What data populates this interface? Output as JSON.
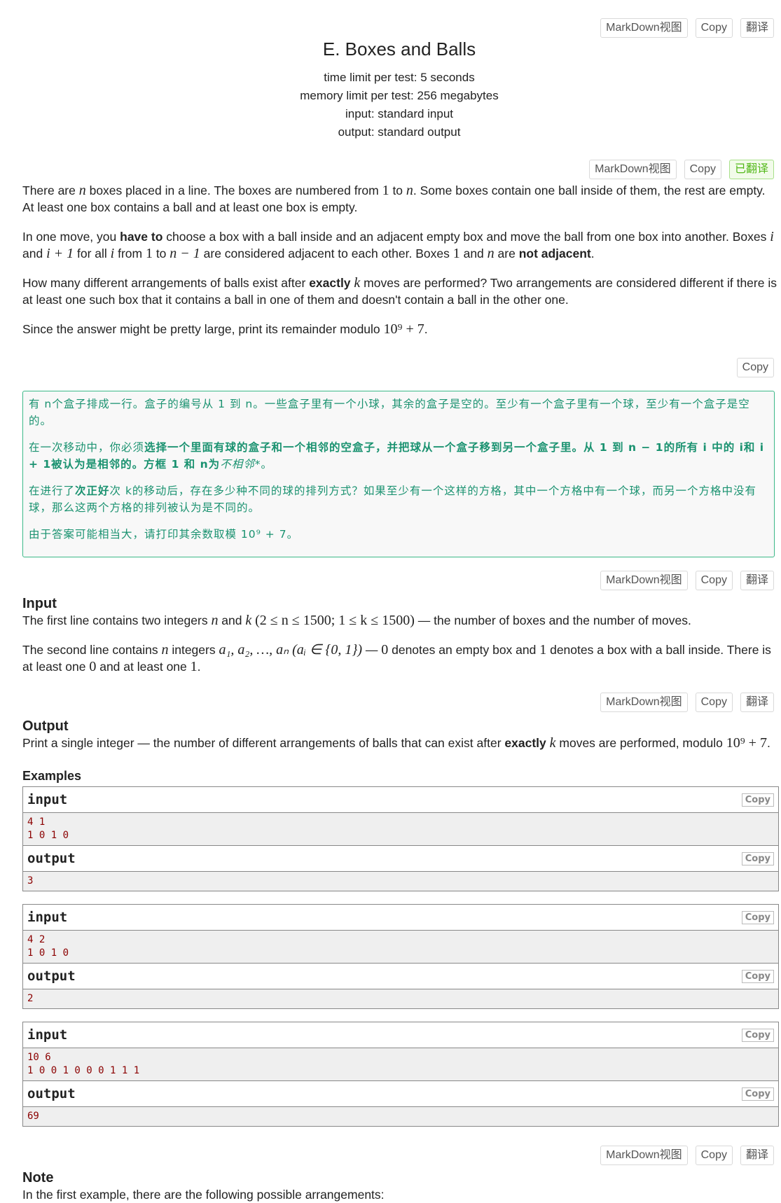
{
  "toolbar_labels": {
    "markdown": "MarkDown视图",
    "copy": "Copy",
    "translate": "翻译",
    "translated": "已翻译"
  },
  "header": {
    "title": "E. Boxes and Balls",
    "time_limit": "time limit per test: 5 seconds",
    "memory_limit": "memory limit per test: 256 megabytes",
    "input": "input: standard input",
    "output": "output: standard output"
  },
  "statement": {
    "p1_a": "There are ",
    "p1_b": " boxes placed in a line. The boxes are numbered from ",
    "p1_c": " to ",
    "p1_d": ". Some boxes contain one ball inside of them, the rest are empty. At least one box contains a ball and at least one box is empty.",
    "p2_a": "In one move, you ",
    "p2_bold1": "have to",
    "p2_b": " choose a box with a ball inside and an adjacent empty box and move the ball from one box into another. Boxes ",
    "p2_c": " and ",
    "p2_d": " for all ",
    "p2_e": " from ",
    "p2_f": " to ",
    "p2_g": " are considered adjacent to each other. Boxes ",
    "p2_h": " and ",
    "p2_i": " are ",
    "p2_bold2": "not adjacent",
    "p2_j": ".",
    "p3_a": "How many different arrangements of balls exist after ",
    "p3_bold": "exactly",
    "p3_b": " moves are performed? Two arrangements are considered different if there is at least one such box that it contains a ball in one of them and doesn't contain a ball in the other one.",
    "p4_a": "Since the answer might be pretty large, print its remainder modulo ",
    "p4_b": "."
  },
  "math": {
    "n": "n",
    "one": "1",
    "i": "i",
    "i_plus_1": "i + 1",
    "n_minus_1": "n − 1",
    "k": "k",
    "mod": "10⁹ + 7"
  },
  "translation": {
    "p1": "有 n个盒子排成一行。盒子的编号从 1 到 n。一些盒子里有一个小球，其余的盒子是空的。至少有一个盒子里有一个球，至少有一个盒子是空的。",
    "p2_a": "在一次移动中，你必须",
    "p2_bold": "选择一个里面有球的盒子和一个相邻的空盒子，并把球从一个盒子移到另一个盒子里。从 1 到 n − 1的所有 i 中的 i和 i + 1被认为是相邻的。方框 1 和 n为",
    "p2_italic": "不相邻*",
    "p2_end": "。",
    "p3_a": "在进行了",
    "p3_bold": "次正好",
    "p3_b": "次 k的移动后，存在多少种不同的球的排列方式？如果至少有一个这样的方格，其中一个方格中有一个球，而另一个方格中没有球，那么这两个方格的排列被认为是不同的。",
    "p4": "由于答案可能相当大，请打印其余数取模 10⁹ + 7。"
  },
  "input_section": {
    "title": "Input",
    "p1_a": "The first line contains two integers ",
    "p1_b": " and ",
    "p1_c": " (2 ≤ n ≤ 1500; 1 ≤ k ≤ 1500)",
    "p1_d": " — the number of boxes and the number of moves.",
    "p2_a": "The second line contains ",
    "p2_b": " integers ",
    "p2_c": "a₁, a₂, …, aₙ (aᵢ ∈ {0, 1})",
    "p2_d": " — ",
    "p2_e": "0",
    "p2_f": " denotes an empty box and ",
    "p2_g": "1",
    "p2_h": " denotes a box with a ball inside. There is at least one ",
    "p2_i": "0",
    "p2_j": " and at least one ",
    "p2_k": "1",
    "p2_l": "."
  },
  "output_section": {
    "title": "Output",
    "p_a": "Print a single integer — the number of different arrangements of balls that can exist after ",
    "p_bold": "exactly",
    "p_b": " moves are performed, modulo ",
    "p_c": "."
  },
  "examples": {
    "title": "Examples",
    "input_label": "input",
    "output_label": "output",
    "copy_label": "Copy",
    "items": [
      {
        "input": "4 1\n1 0 1 0",
        "output": "3"
      },
      {
        "input": "4 2\n1 0 1 0",
        "output": "2"
      },
      {
        "input": "10 6\n1 0 0 1 0 0 0 1 1 1",
        "output": "69"
      }
    ]
  },
  "note": {
    "title": "Note",
    "text": "In the first example, there are the following possible arrangements:"
  }
}
